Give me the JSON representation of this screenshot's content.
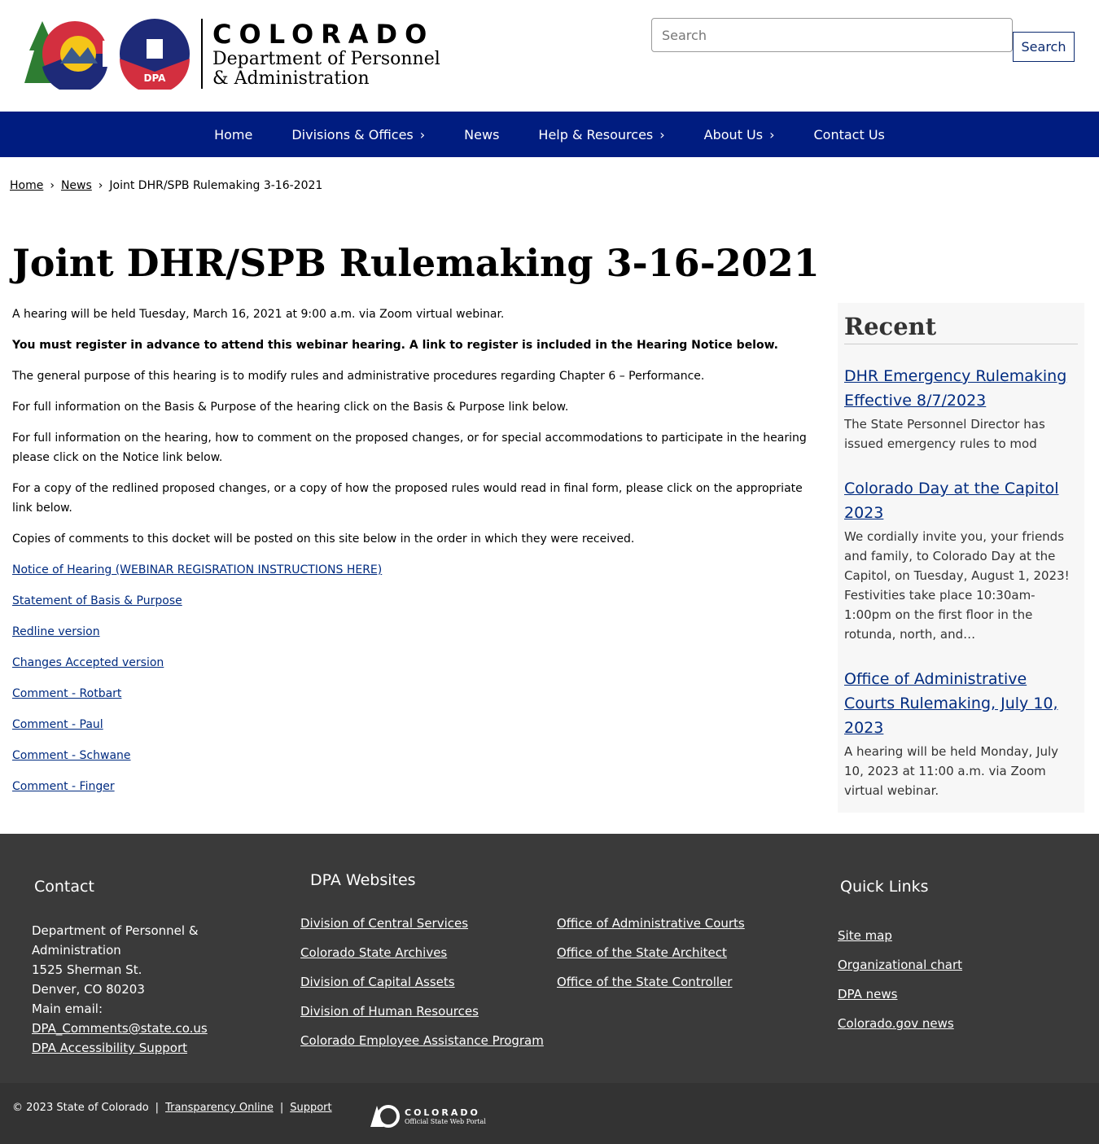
{
  "header": {
    "brand_line1": "COLORADO",
    "brand_line2": "Department of Personnel",
    "brand_line3": "& Administration",
    "logo_badge": "DPA",
    "search_placeholder": "Search",
    "search_button": "Search"
  },
  "nav": [
    {
      "label": "Home",
      "chevron": false
    },
    {
      "label": "Divisions & Offices",
      "chevron": true
    },
    {
      "label": "News",
      "chevron": false
    },
    {
      "label": "Help & Resources",
      "chevron": true
    },
    {
      "label": "About Us",
      "chevron": true
    },
    {
      "label": "Contact Us",
      "chevron": false
    }
  ],
  "breadcrumb": {
    "home": "Home",
    "news": "News",
    "current": "Joint DHR/SPB Rulemaking 3-16-2021"
  },
  "title": "Joint DHR/SPB Rulemaking 3-16-2021",
  "body": {
    "p1": "A hearing will be held Tuesday, March 16, 2021 at 9:00 a.m. via Zoom virtual webinar.",
    "p2": "You must register in advance to attend this webinar hearing.  A link to register is included in the Hearing Notice below.",
    "p3": "The general purpose of this hearing is to modify rules and administrative procedures regarding Chapter 6 – Performance.",
    "p4": "For full information on the Basis & Purpose of the hearing click on the Basis & Purpose link below.",
    "p5": "For full information on the hearing, how to comment on the proposed changes, or for special accommodations to participate in the hearing please click on the Notice link below.",
    "p6": "For a copy of the redlined proposed changes, or a copy of how the proposed rules would read in final form, please click on the appropriate link below.",
    "p7": "Copies of comments to this docket will be posted on this site below in the order in which they were received.",
    "links": [
      "Notice of Hearing (WEBINAR REGISRATION INSTRUCTIONS HERE)",
      "Statement of Basis & Purpose",
      "Redline version",
      "Changes Accepted version",
      "Comment - Rotbart",
      "Comment - Paul",
      "Comment - Schwane",
      "Comment - Finger"
    ]
  },
  "recent": {
    "heading": "Recent",
    "items": [
      {
        "title": "DHR Emergency Rulemaking Effective 8/7/2023",
        "summary": "The State Personnel Director has issued emergency rules to mod"
      },
      {
        "title": "Colorado Day at the Capitol 2023",
        "summary": "We cordially invite you, your friends and family, to Colorado Day at the Capitol, on Tuesday, August 1, 2023!  Festivities take place 10:30am-1:00pm on the first floor in the rotunda, north, and…"
      },
      {
        "title": "Office of Administrative Courts Rulemaking, July 10, 2023",
        "summary": "A hearing will be held Monday, July 10, 2023 at 11:00 a.m. via Zoom virtual webinar."
      }
    ]
  },
  "footer": {
    "contact_heading": "Contact",
    "contact_lines": [
      "Department of Personnel &",
      "Administration",
      "1525 Sherman St.",
      "Denver, CO 80203",
      "Main email:"
    ],
    "email": "DPA_Comments@state.co.us",
    "accessibility": "DPA Accessibility Support",
    "websites_heading": "DPA Websites",
    "websites_col1": [
      "Division of Central Services",
      "Colorado State Archives",
      "Division of Capital Assets",
      "Division of Human Resources",
      "Colorado Employee Assistance Program"
    ],
    "websites_col2": [
      "Office of Administrative Courts",
      "Office of the State Architect",
      "Office of the State Controller"
    ],
    "quick_heading": "Quick Links",
    "quick_links": [
      "Site map",
      "Organizational chart",
      "DPA news",
      "Colorado.gov news"
    ]
  },
  "bottom": {
    "copyright": "© 2023 State of Colorado",
    "sep": "|",
    "transparency": "Transparency Online",
    "support": "Support",
    "portal_line1": "COLORADO",
    "portal_line2": "Official State Web Portal"
  }
}
